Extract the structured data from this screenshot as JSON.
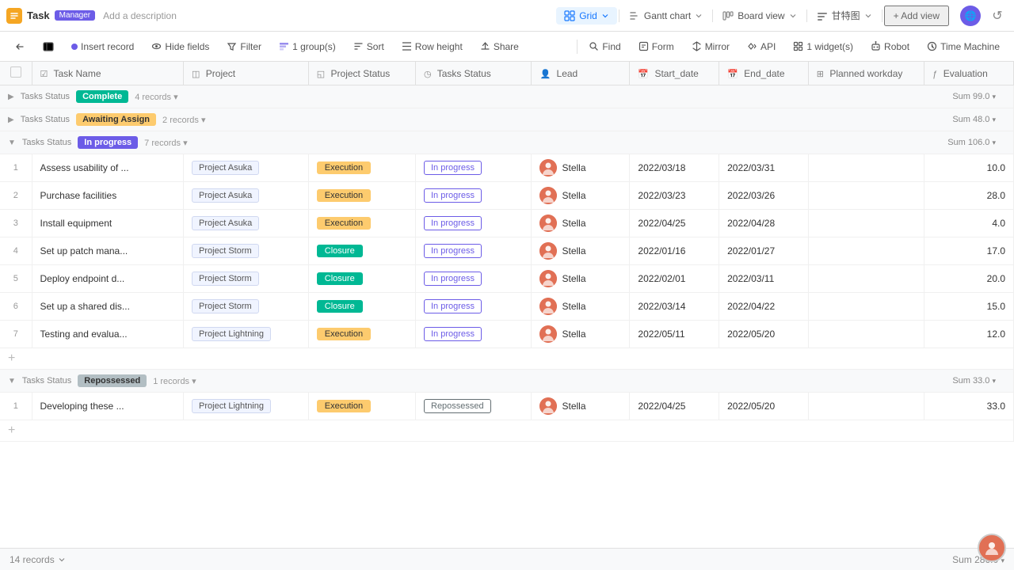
{
  "app": {
    "title": "Task",
    "badge": "Manager",
    "description": "Add a description"
  },
  "views": [
    {
      "id": "grid",
      "label": "Grid",
      "icon": "grid-icon",
      "active": true
    },
    {
      "id": "gantt",
      "label": "Gantt chart",
      "icon": "gantt-icon",
      "active": false
    },
    {
      "id": "board",
      "label": "Board view",
      "icon": "board-icon",
      "active": false
    },
    {
      "id": "special",
      "label": "甘特图",
      "icon": "special-icon",
      "active": false
    }
  ],
  "add_view_label": "+ Add view",
  "toolbar": {
    "insert_record": "Insert record",
    "hide_fields": "Hide fields",
    "filter": "Filter",
    "group": "1 group(s)",
    "sort": "Sort",
    "row_height": "Row height",
    "share": "Share",
    "find": "Find",
    "form": "Form",
    "mirror": "Mirror",
    "api": "API",
    "widget": "1 widget(s)",
    "robot": "Robot",
    "time_machine": "Time Machine"
  },
  "columns": [
    {
      "id": "task_name",
      "label": "Task Name",
      "icon": "task-icon"
    },
    {
      "id": "project",
      "label": "Project",
      "icon": "project-icon"
    },
    {
      "id": "project_status",
      "label": "Project Status",
      "icon": "status-icon"
    },
    {
      "id": "tasks_status",
      "label": "Tasks Status",
      "icon": "tasks-icon"
    },
    {
      "id": "lead",
      "label": "Lead",
      "icon": "lead-icon"
    },
    {
      "id": "start_date",
      "label": "Start_date",
      "icon": "date-icon"
    },
    {
      "id": "end_date",
      "label": "End_date",
      "icon": "date-icon"
    },
    {
      "id": "planned_workday",
      "label": "Planned workday",
      "icon": "calc-icon"
    },
    {
      "id": "evaluation",
      "label": "Evaluation",
      "icon": "eval-icon"
    }
  ],
  "groups": [
    {
      "id": "complete",
      "label": "Tasks Status",
      "badge": "Complete",
      "badge_type": "complete",
      "records_count": "4 records",
      "sum": "Sum 99.0",
      "collapsed": true,
      "rows": []
    },
    {
      "id": "awaiting",
      "label": "Tasks Status",
      "badge": "Awaiting Assign",
      "badge_type": "awaiting",
      "records_count": "2 records",
      "sum": "Sum 48.0",
      "collapsed": true,
      "rows": []
    },
    {
      "id": "inprogress",
      "label": "Tasks Status",
      "badge": "In progress",
      "badge_type": "inprogress",
      "records_count": "7 records",
      "sum": "Sum 106.0",
      "collapsed": false,
      "rows": [
        {
          "num": "1",
          "task": "Assess usability of ...",
          "project": "Project Asuka",
          "proj_status": "Execution",
          "proj_status_type": "execution",
          "task_status": "In progress",
          "lead": "Stella",
          "start": "2022/03/18",
          "end": "2022/03/31",
          "evaluation": "10.0"
        },
        {
          "num": "2",
          "task": "Purchase facilities",
          "project": "Project Asuka",
          "proj_status": "Execution",
          "proj_status_type": "execution",
          "task_status": "In progress",
          "lead": "Stella",
          "start": "2022/03/23",
          "end": "2022/03/26",
          "evaluation": "28.0"
        },
        {
          "num": "3",
          "task": "Install equipment",
          "project": "Project Asuka",
          "proj_status": "Execution",
          "proj_status_type": "execution",
          "task_status": "In progress",
          "lead": "Stella",
          "start": "2022/04/25",
          "end": "2022/04/28",
          "evaluation": "4.0"
        },
        {
          "num": "4",
          "task": "Set up patch mana...",
          "project": "Project Storm",
          "proj_status": "Closure",
          "proj_status_type": "closure",
          "task_status": "In progress",
          "lead": "Stella",
          "start": "2022/01/16",
          "end": "2022/01/27",
          "evaluation": "17.0"
        },
        {
          "num": "5",
          "task": "Deploy endpoint d...",
          "project": "Project Storm",
          "proj_status": "Closure",
          "proj_status_type": "closure",
          "task_status": "In progress",
          "lead": "Stella",
          "start": "2022/02/01",
          "end": "2022/03/11",
          "evaluation": "20.0"
        },
        {
          "num": "6",
          "task": "Set up a shared dis...",
          "project": "Project Storm",
          "proj_status": "Closure",
          "proj_status_type": "closure",
          "task_status": "In progress",
          "lead": "Stella",
          "start": "2022/03/14",
          "end": "2022/04/22",
          "evaluation": "15.0"
        },
        {
          "num": "7",
          "task": "Testing and evalua...",
          "project": "Project Lightning",
          "proj_status": "Execution",
          "proj_status_type": "execution",
          "task_status": "In progress",
          "lead": "Stella",
          "start": "2022/05/11",
          "end": "2022/05/20",
          "evaluation": "12.0"
        }
      ]
    },
    {
      "id": "repossessed",
      "label": "Tasks Status",
      "badge": "Repossessed",
      "badge_type": "repossessed",
      "records_count": "1 records",
      "sum": "Sum 33.0",
      "collapsed": false,
      "rows": [
        {
          "num": "1",
          "task": "Developing these ...",
          "project": "Project Lightning",
          "proj_status": "Execution",
          "proj_status_type": "execution",
          "task_status": "Repossessed",
          "lead": "Stella",
          "start": "2022/04/25",
          "end": "2022/05/20",
          "evaluation": "33.0"
        }
      ]
    }
  ],
  "footer": {
    "records": "14 records",
    "sum": "Sum 286.0"
  }
}
